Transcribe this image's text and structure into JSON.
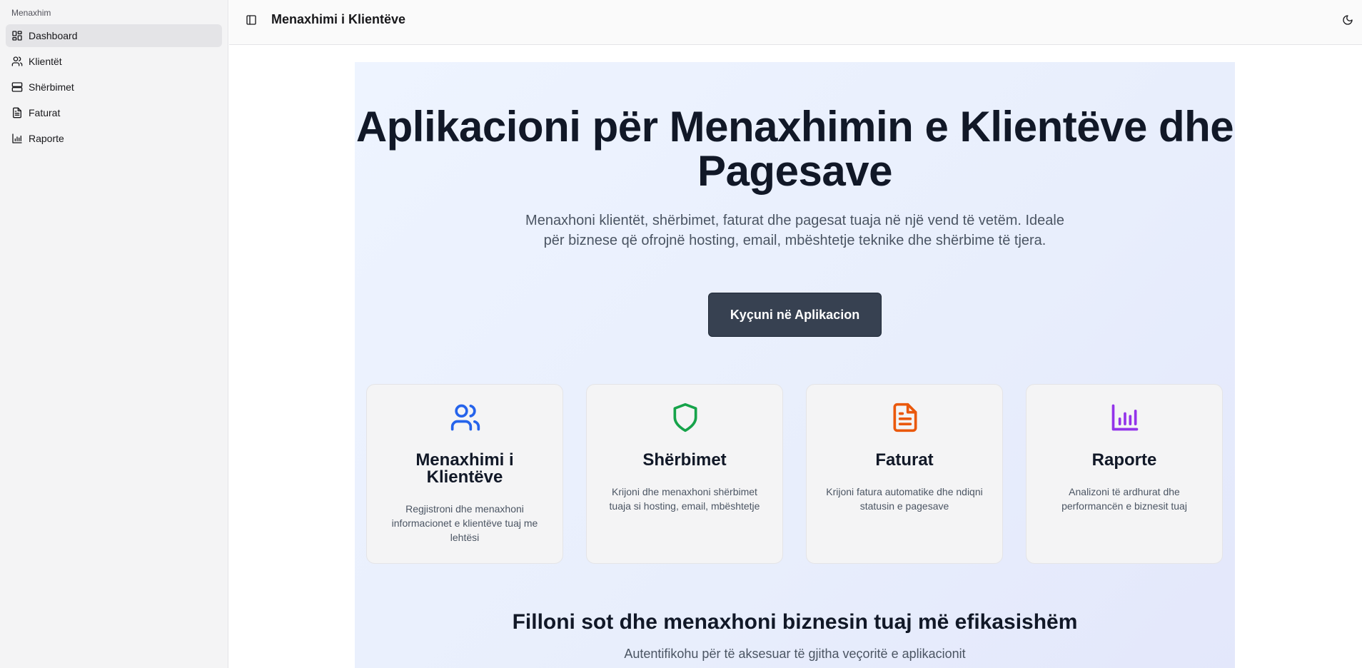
{
  "sidebar": {
    "group_label": "Menaxhim",
    "items": [
      {
        "label": "Dashboard",
        "icon": "dashboard-icon",
        "active": true
      },
      {
        "label": "Klientët",
        "icon": "users-icon"
      },
      {
        "label": "Shërbimet",
        "icon": "server-icon"
      },
      {
        "label": "Faturat",
        "icon": "file-text-icon"
      },
      {
        "label": "Raporte",
        "icon": "bar-chart-icon"
      }
    ]
  },
  "header": {
    "title": "Menaxhimi i Klientëve",
    "toggle_icon": "sidebar-toggle-icon",
    "theme_icon": "moon-icon"
  },
  "hero": {
    "title": "Aplikacioni për Menaxhimin e Klientëve dhe Pagesave",
    "subtitle": "Menaxhoni klientët, shërbimet, faturat dhe pagesat tuaja në një vend të vetëm. Ideale për biznese që ofrojnë hosting, email, mbështetje teknike dhe shërbime të tjera.",
    "cta_label": "Kyçuni në Aplikacion"
  },
  "features": [
    {
      "title": "Menaxhimi i Klientëve",
      "description": "Regjistroni dhe menaxhoni informacionet e klientëve tuaj me lehtësi",
      "icon": "users-icon",
      "color": "#2563eb"
    },
    {
      "title": "Shërbimet",
      "description": "Krijoni dhe menaxhoni shërbimet tuaja si hosting, email, mbështetje",
      "icon": "shield-icon",
      "color": "#16a34a"
    },
    {
      "title": "Faturat",
      "description": "Krijoni fatura automatike dhe ndiqni statusin e pagesave",
      "icon": "file-text-icon",
      "color": "#ea580c"
    },
    {
      "title": "Raporte",
      "description": "Analizoni të ardhurat dhe performancën e biznesit tuaj",
      "icon": "bar-chart-icon",
      "color": "#9333ea"
    }
  ],
  "bottom": {
    "title": "Filloni sot dhe menaxhoni biznesin tuaj më efikasishëm",
    "subtitle": "Autentifikohu për të aksesuar të gjitha veçoritë e aplikacionit"
  }
}
